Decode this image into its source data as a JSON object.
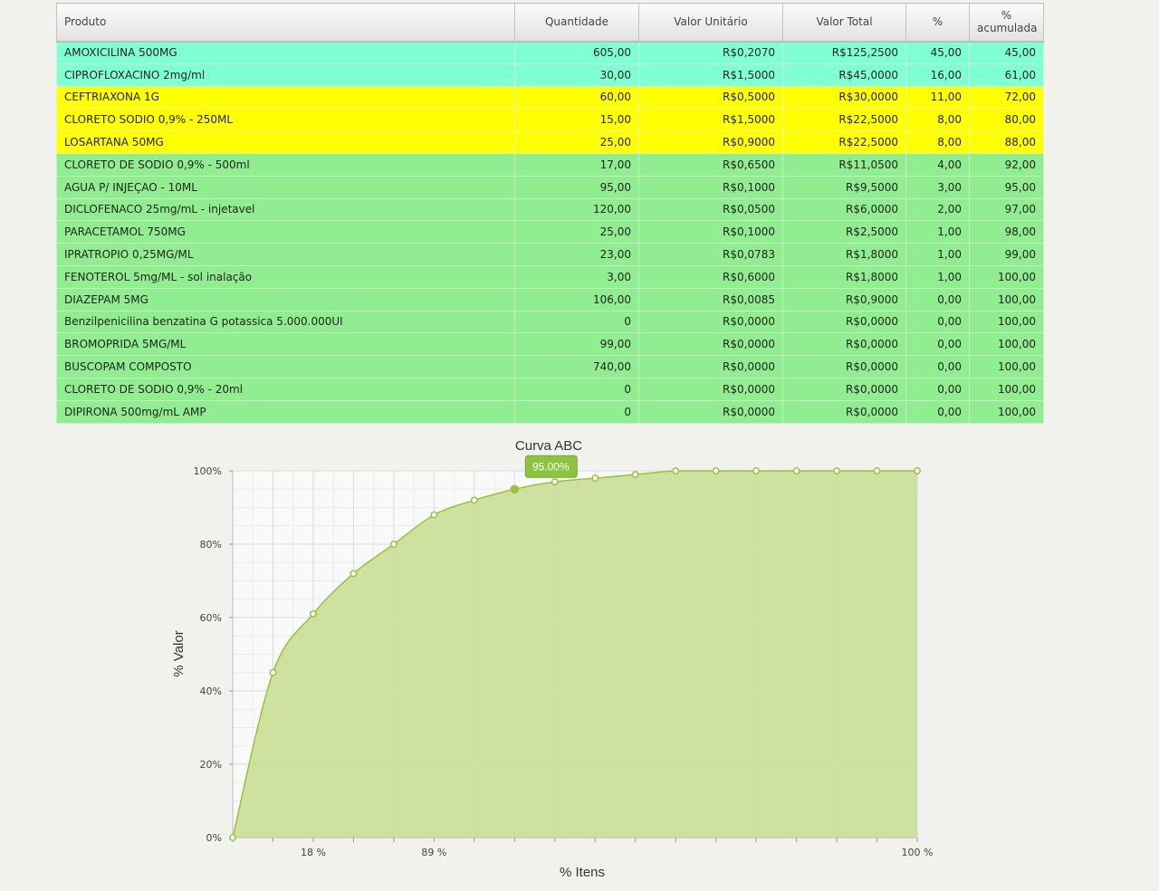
{
  "table": {
    "headers": {
      "produto": "Produto",
      "quantidade": "Quantidade",
      "valor_unitario": "Valor Unitário",
      "valor_total": "Valor Total",
      "percent": "%",
      "percent_acum_line1": "%",
      "percent_acum_line2": "acumulada"
    },
    "rows": [
      {
        "produto": "AMOXICILINA 500MG",
        "quantidade": "605,00",
        "valor_unitario": "R$0,2070",
        "valor_total": "R$125,2500",
        "percent": "45,00",
        "acumulada": "45,00",
        "classe": "a"
      },
      {
        "produto": "CIPROFLOXACINO 2mg/ml",
        "quantidade": "30,00",
        "valor_unitario": "R$1,5000",
        "valor_total": "R$45,0000",
        "percent": "16,00",
        "acumulada": "61,00",
        "classe": "a"
      },
      {
        "produto": "CEFTRIAXONA 1G",
        "quantidade": "60,00",
        "valor_unitario": "R$0,5000",
        "valor_total": "R$30,0000",
        "percent": "11,00",
        "acumulada": "72,00",
        "classe": "b"
      },
      {
        "produto": "CLORETO SODIO 0,9% - 250ML",
        "quantidade": "15,00",
        "valor_unitario": "R$1,5000",
        "valor_total": "R$22,5000",
        "percent": "8,00",
        "acumulada": "80,00",
        "classe": "b"
      },
      {
        "produto": "LOSARTANA 50MG",
        "quantidade": "25,00",
        "valor_unitario": "R$0,9000",
        "valor_total": "R$22,5000",
        "percent": "8,00",
        "acumulada": "88,00",
        "classe": "b"
      },
      {
        "produto": "CLORETO DE SODIO 0,9% - 500ml",
        "quantidade": "17,00",
        "valor_unitario": "R$0,6500",
        "valor_total": "R$11,0500",
        "percent": "4,00",
        "acumulada": "92,00",
        "classe": "c"
      },
      {
        "produto": "AGUA P/ INJEÇAO - 10ML",
        "quantidade": "95,00",
        "valor_unitario": "R$0,1000",
        "valor_total": "R$9,5000",
        "percent": "3,00",
        "acumulada": "95,00",
        "classe": "c"
      },
      {
        "produto": "DICLOFENACO 25mg/mL - injetavel",
        "quantidade": "120,00",
        "valor_unitario": "R$0,0500",
        "valor_total": "R$6,0000",
        "percent": "2,00",
        "acumulada": "97,00",
        "classe": "c"
      },
      {
        "produto": "PARACETAMOL 750MG",
        "quantidade": "25,00",
        "valor_unitario": "R$0,1000",
        "valor_total": "R$2,5000",
        "percent": "1,00",
        "acumulada": "98,00",
        "classe": "c"
      },
      {
        "produto": "IPRATROPIO 0,25MG/ML",
        "quantidade": "23,00",
        "valor_unitario": "R$0,0783",
        "valor_total": "R$1,8000",
        "percent": "1,00",
        "acumulada": "99,00",
        "classe": "c"
      },
      {
        "produto": "FENOTEROL 5mg/ML - sol inalação",
        "quantidade": "3,00",
        "valor_unitario": "R$0,6000",
        "valor_total": "R$1,8000",
        "percent": "1,00",
        "acumulada": "100,00",
        "classe": "c"
      },
      {
        "produto": "DIAZEPAM 5MG",
        "quantidade": "106,00",
        "valor_unitario": "R$0,0085",
        "valor_total": "R$0,9000",
        "percent": "0,00",
        "acumulada": "100,00",
        "classe": "c"
      },
      {
        "produto": "Benzilpenicilina benzatina G potassica 5.000.000UI",
        "quantidade": "0",
        "valor_unitario": "R$0,0000",
        "valor_total": "R$0,0000",
        "percent": "0,00",
        "acumulada": "100,00",
        "classe": "c"
      },
      {
        "produto": "BROMOPRIDA 5MG/ML",
        "quantidade": "99,00",
        "valor_unitario": "R$0,0000",
        "valor_total": "R$0,0000",
        "percent": "0,00",
        "acumulada": "100,00",
        "classe": "c"
      },
      {
        "produto": "BUSCOPAM COMPOSTO",
        "quantidade": "740,00",
        "valor_unitario": "R$0,0000",
        "valor_total": "R$0,0000",
        "percent": "0,00",
        "acumulada": "100,00",
        "classe": "c"
      },
      {
        "produto": "CLORETO DE SODIO 0,9% - 20ml",
        "quantidade": "0",
        "valor_unitario": "R$0,0000",
        "valor_total": "R$0,0000",
        "percent": "0,00",
        "acumulada": "100,00",
        "classe": "c"
      },
      {
        "produto": "DIPIRONA 500mg/mL AMP",
        "quantidade": "0",
        "valor_unitario": "R$0,0000",
        "valor_total": "R$0,0000",
        "percent": "0,00",
        "acumulada": "100,00",
        "classe": "c"
      }
    ],
    "class_colors": {
      "a": "#7fffd4",
      "b": "#ffff00",
      "c": "#90ee90"
    }
  },
  "chart_data": {
    "type": "area",
    "title": "Curva ABC",
    "xlabel": "% Itens",
    "ylabel": "% Valor",
    "x": [
      0,
      1,
      2,
      3,
      4,
      5,
      6,
      7,
      8,
      9,
      10,
      11,
      12,
      13,
      14,
      15,
      16,
      17
    ],
    "y": [
      0,
      45,
      61,
      72,
      80,
      88,
      92,
      95,
      97,
      98,
      99,
      100,
      100,
      100,
      100,
      100,
      100,
      100
    ],
    "xlim": [
      0,
      17
    ],
    "ylim": [
      0,
      100
    ],
    "y_ticks": [
      "0%",
      "20%",
      "40%",
      "60%",
      "80%",
      "100%"
    ],
    "x_tick_labels": [
      {
        "x": 2,
        "label": "18 %"
      },
      {
        "x": 5,
        "label": "89 %"
      },
      {
        "x": 17,
        "label": "100 %"
      }
    ],
    "highlighted_point_index": 7,
    "tooltip": "95.00%",
    "grid": true,
    "colors": {
      "fill": "#cbdf9a",
      "line": "#9ac13e",
      "tooltip_bg": "#8cc43f"
    }
  }
}
